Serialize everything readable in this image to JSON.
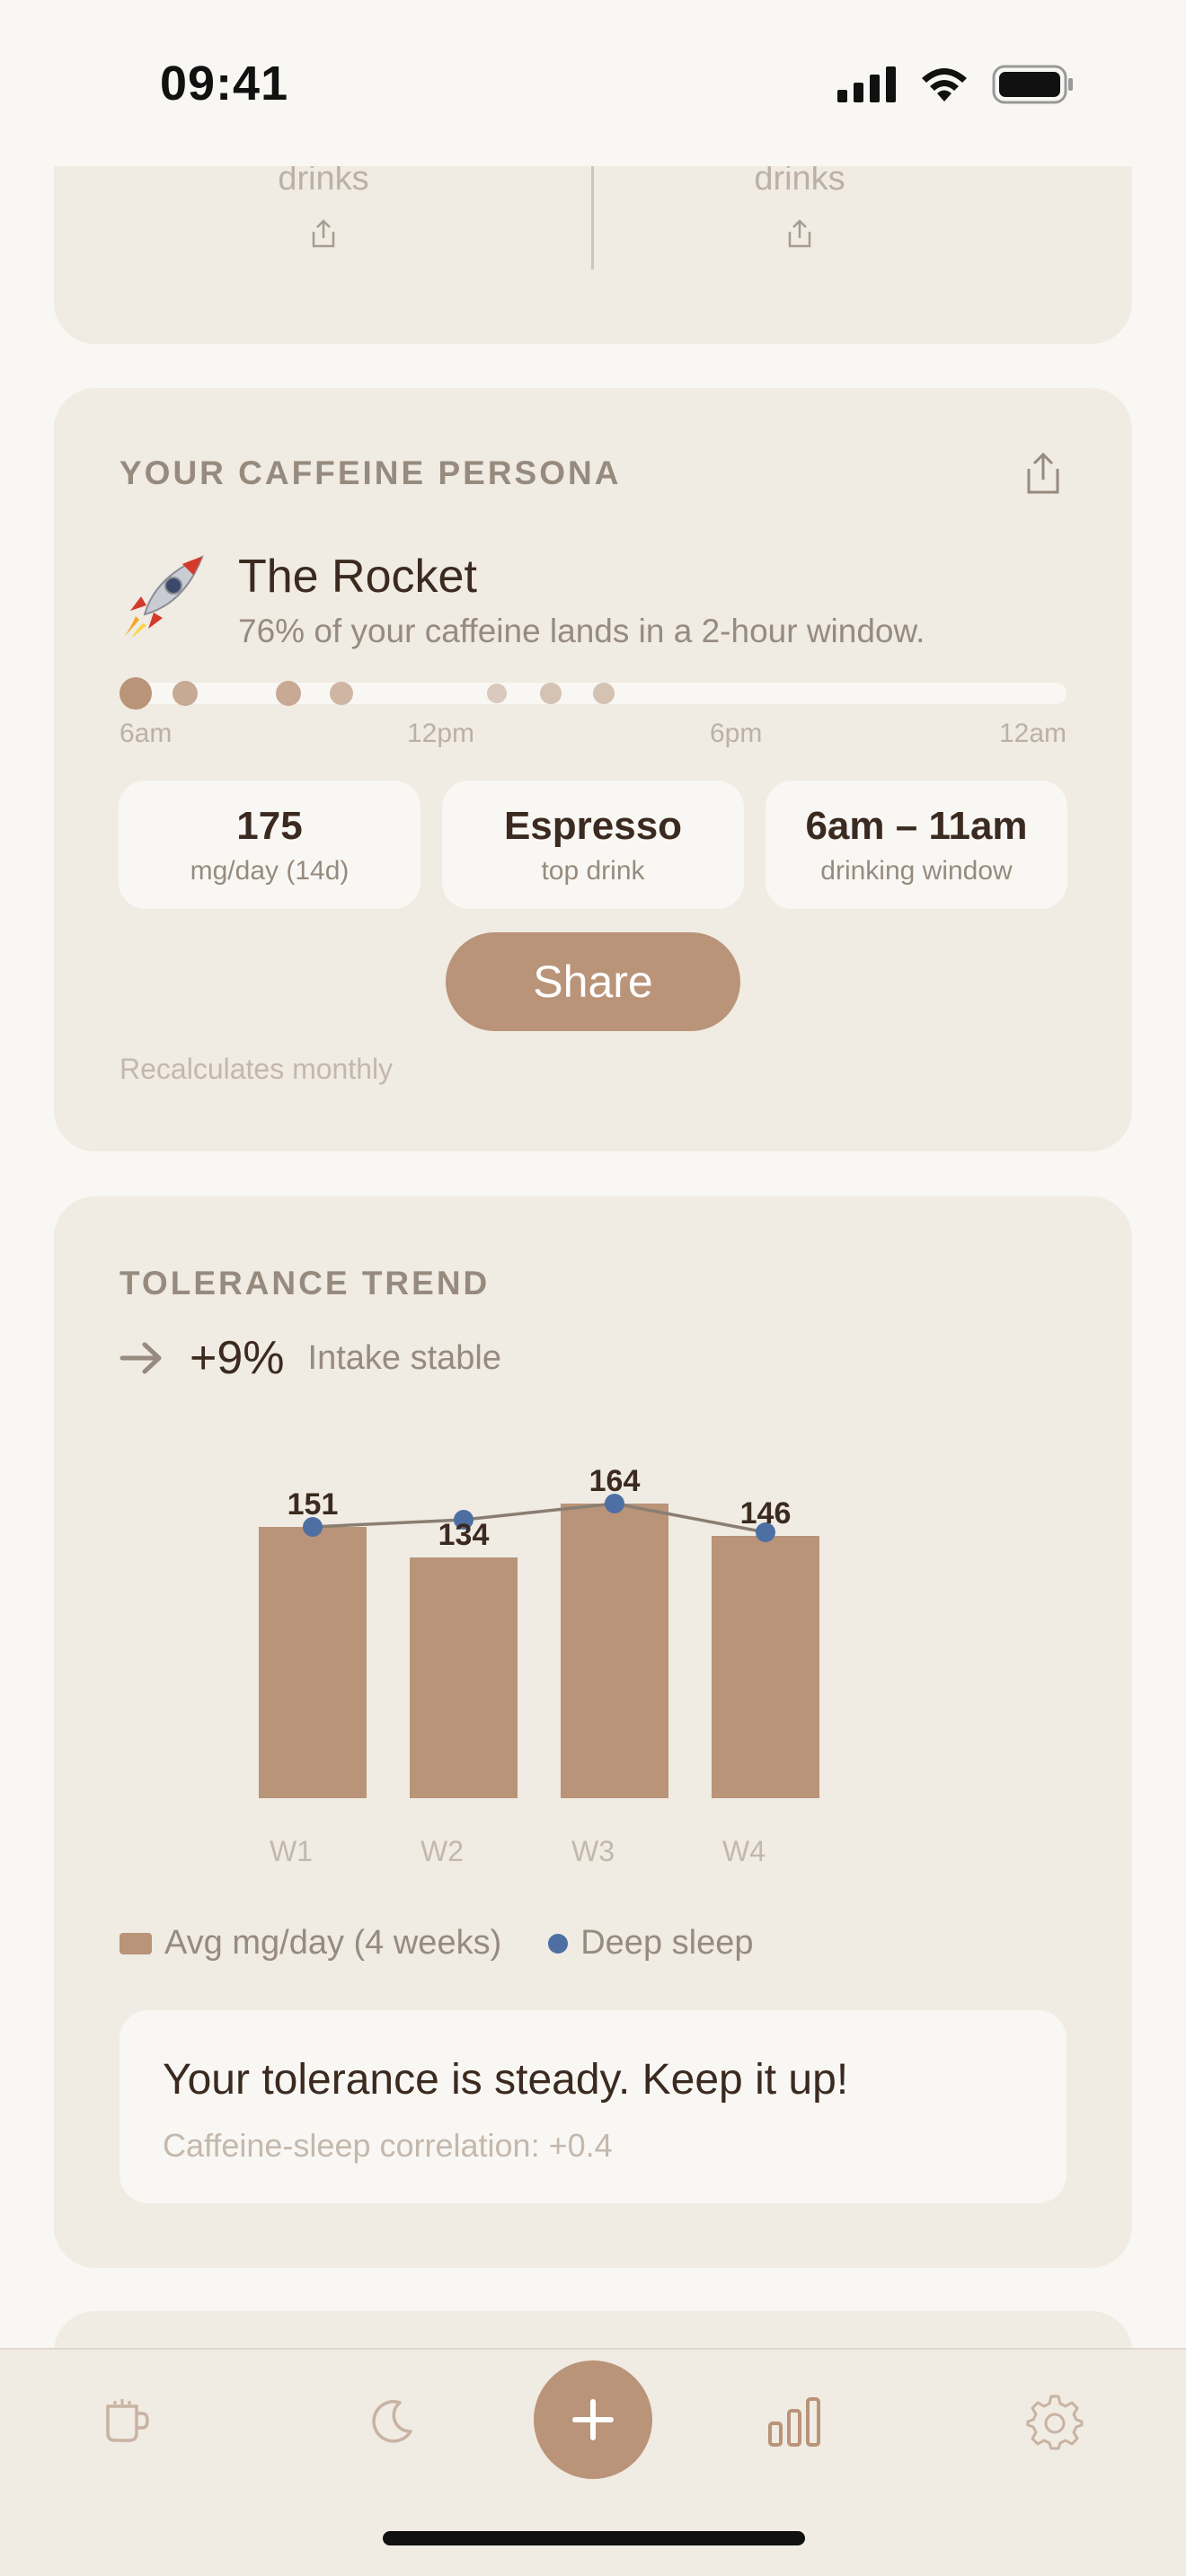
{
  "status_bar": {
    "time": "09:41"
  },
  "top_card": {
    "left_label": "drinks",
    "right_label": "drinks"
  },
  "persona": {
    "section_title": "YOUR CAFFEINE PERSONA",
    "emoji": "🚀",
    "name": "The Rocket",
    "description": "76% of your caffeine lands in a 2-hour window.",
    "timeline_labels": [
      "6am",
      "12pm",
      "6pm",
      "12am"
    ],
    "stats": [
      {
        "value": "175",
        "label": "mg/day (14d)"
      },
      {
        "value": "Espresso",
        "label": "top drink"
      },
      {
        "value": "6am – 11am",
        "label": "drinking window"
      }
    ],
    "share_label": "Share",
    "footnote": "Recalculates monthly"
  },
  "trend": {
    "section_title": "TOLERANCE TREND",
    "change": "+9%",
    "status": "Intake stable",
    "legend_bar": "Avg mg/day (4 weeks)",
    "legend_dot": "Deep sleep",
    "insight_title": "Your tolerance is steady. Keep it up!",
    "insight_sub": "Caffeine-sleep correlation: +0.4"
  },
  "chart_data": {
    "type": "bar",
    "categories": [
      "W1",
      "W2",
      "W3",
      "W4"
    ],
    "series": [
      {
        "name": "Avg mg/day (4 weeks)",
        "values": [
          151,
          134,
          164,
          146
        ]
      },
      {
        "name": "Deep sleep",
        "values": [
          151,
          155,
          164,
          148
        ]
      }
    ],
    "data_labels": [
      "151",
      "134",
      "164",
      "146"
    ],
    "ylim": [
      0,
      170
    ],
    "colors": {
      "bar": "#b99479",
      "dot": "#4d6fa3",
      "line": "#8a7e72"
    }
  },
  "tab_bar": {
    "tabs": [
      "cup-icon",
      "moon-icon",
      "add-icon",
      "bar-chart-icon",
      "gear-icon"
    ]
  }
}
